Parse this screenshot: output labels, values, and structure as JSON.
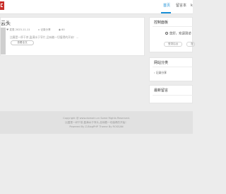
{
  "nav": {
    "items": [
      {
        "label": "首页",
        "active": true
      },
      {
        "label": "留言本",
        "active": false
      },
      {
        "label": "k",
        "active": false
      }
    ]
  },
  "post": {
    "title": "云头",
    "meta": {
      "date": "2023-11-11",
      "category": "记录分享",
      "views": "60"
    },
    "excerpt": "比翼是一杯干茶,盈满水于窄片,品味着一切值得的开始！...",
    "read_more": "查看全文"
  },
  "sidebar": {
    "control": {
      "title": "控制面板",
      "greeting": "您好，欢迎到访",
      "buttons": [
        "登录后台",
        "查"
      ]
    },
    "categories": {
      "title": "网站分类",
      "items": [
        "记录分享"
      ]
    },
    "comments": {
      "title": "最新留言"
    }
  },
  "footer": {
    "copyright": "Copyright @ www.domain.cn Some Rights Reserved.",
    "motto": "比翼是一杯干茶,盈满水于窄片,品味着一切值得的开始！",
    "powered": "Powered By Z-BlogPHP Theme By ROSSAN"
  },
  "colors": {
    "accent": "#1a8fd6",
    "logo": "#c9302c"
  }
}
